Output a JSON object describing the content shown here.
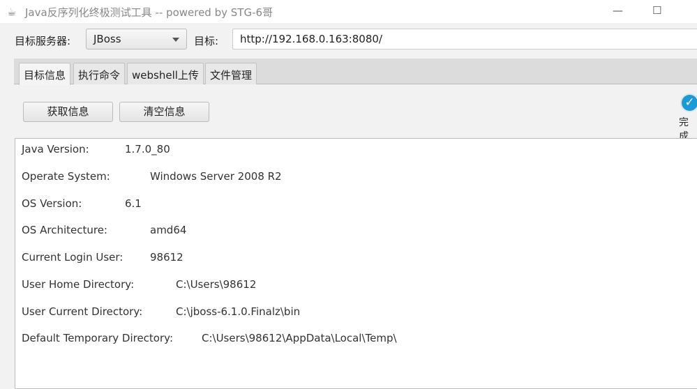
{
  "window": {
    "title": "Java反序列化终极测试工具  -- powered by STG-6哥",
    "minimize": "—",
    "maximize": "☐"
  },
  "toolbar": {
    "server_label": "目标服务器:",
    "server_value": "JBoss",
    "target_label": "目标:",
    "target_value": "http://192.168.0.163:8080/"
  },
  "tabs": [
    "目标信息",
    "执行命令",
    "webshell上传",
    "文件管理"
  ],
  "buttons": {
    "get_info": "获取信息",
    "clear_info": "清空信息"
  },
  "status": {
    "text": "完成",
    "icon": "check-circle-icon",
    "color": "#1a9ad6"
  },
  "info": [
    {
      "key": "Java Version:",
      "value": "1.7.0_80"
    },
    {
      "key": "Operate System:",
      "value": "Windows Server 2008 R2"
    },
    {
      "key": "OS Version:",
      "value": "6.1"
    },
    {
      "key": "OS Architecture:",
      "value": "amd64"
    },
    {
      "key": "Current Login User:",
      "value": "98612"
    },
    {
      "key": "User Home Directory:",
      "value": "C:\\Users\\98612"
    },
    {
      "key": "User Current Directory:",
      "value": "C:\\jboss-6.1.0.Finalz\\bin"
    },
    {
      "key": "Default Temporary Directory:",
      "value": "C:\\Users\\98612\\AppData\\Local\\Temp\\"
    }
  ]
}
